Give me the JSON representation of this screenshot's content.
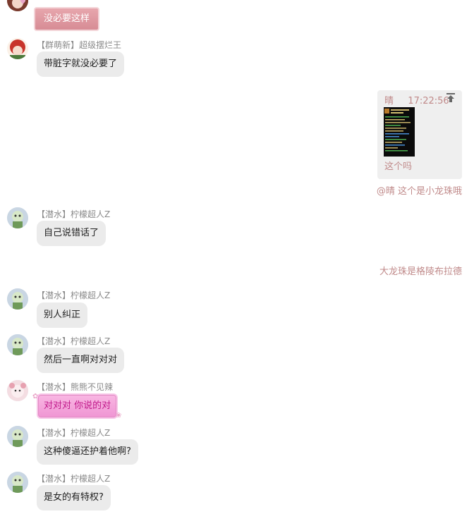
{
  "messages": [
    {
      "nick": "",
      "text": "没必要这样"
    },
    {
      "nick": "【群萌新】超级摆烂王",
      "text": "带脏字就没必要了"
    },
    {
      "nick": "【潜水】柠檬超人Z",
      "text": "自己说错话了"
    },
    {
      "nick": "【潜水】柠檬超人Z",
      "text": "别人纠正"
    },
    {
      "nick": "【潜水】柠檬超人Z",
      "text": "然后一直啊对对对"
    },
    {
      "nick": "【潜水】熊熊不见辣",
      "text": "对对对 你说的对"
    },
    {
      "nick": "【潜水】柠檬超人Z",
      "text": "这种傻逼还护着他啊?"
    },
    {
      "nick": "【潜水】柠檬超人Z",
      "text": "是女的有特权?"
    }
  ],
  "quote": {
    "sender": "晴",
    "time": "17:22:56",
    "caption": "这个吗"
  },
  "right_messages": [
    "@晴 这个是小龙珠哦",
    "大龙珠是格陵布拉德"
  ],
  "colors": {
    "bubble": "#ebebeb",
    "accent_text": "#c08a8a",
    "pink_bubble": "#f4a8dc",
    "rose_bubble": "#dd98a0"
  },
  "icons": {
    "quote_jump": "arrow-up-to-top-icon"
  }
}
